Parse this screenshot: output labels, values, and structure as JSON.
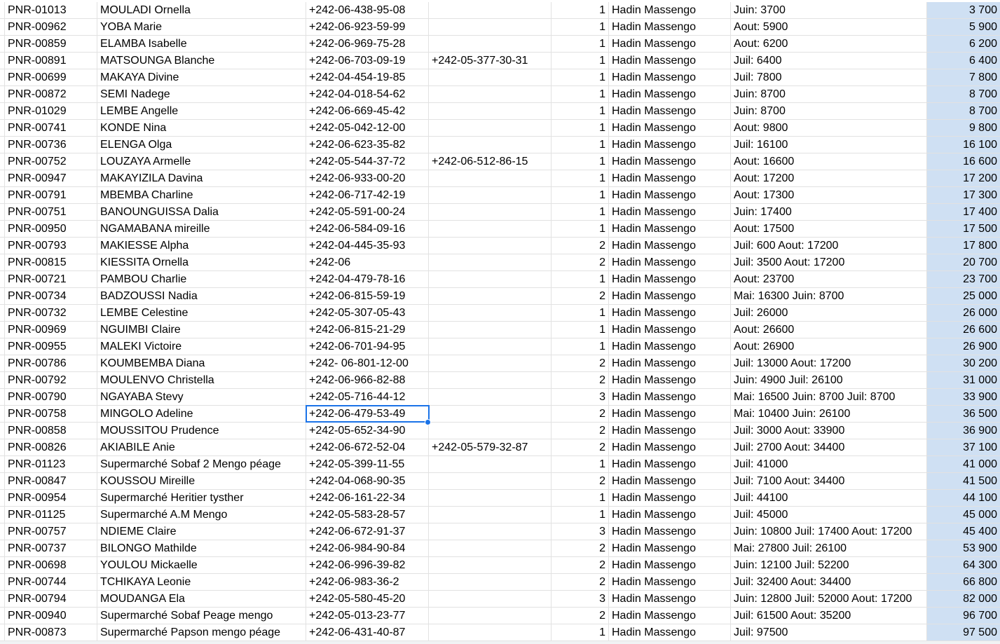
{
  "colors": {
    "grid": "#e2e2e2",
    "selection": "#1a73e8",
    "highlight_column": "#cfe0f3"
  },
  "selected_row_index": 24,
  "rows": [
    [
      "PNR-01013",
      "MOULADI Ornella",
      "+242-06-438-95-08",
      "",
      "1",
      "Hadin Massengo",
      "Juin: 3700",
      "3 700"
    ],
    [
      "PNR-00962",
      "YOBA Marie",
      "+242-06-923-59-99",
      "",
      "1",
      "Hadin Massengo",
      "Aout: 5900",
      "5 900"
    ],
    [
      "PNR-00859",
      "ELAMBA Isabelle",
      "+242-06-969-75-28",
      "",
      "1",
      "Hadin Massengo",
      "Aout: 6200",
      "6 200"
    ],
    [
      "PNR-00891",
      "MATSOUNGA Blanche",
      "+242-06-703-09-19",
      "+242-05-377-30-31",
      "1",
      "Hadin Massengo",
      "Juil: 6400",
      "6 400"
    ],
    [
      "PNR-00699",
      "MAKAYA Divine",
      "+242-04-454-19-85",
      "",
      "1",
      "Hadin Massengo",
      "Juil: 7800",
      "7 800"
    ],
    [
      "PNR-00872",
      "SEMI Nadege",
      "+242-04-018-54-62",
      "",
      "1",
      "Hadin Massengo",
      "Juin: 8700",
      "8 700"
    ],
    [
      "PNR-01029",
      "LEMBE Angelle",
      "+242-06-669-45-42",
      "",
      "1",
      "Hadin Massengo",
      "Juin: 8700",
      "8 700"
    ],
    [
      "PNR-00741",
      "KONDE Nina",
      "+242-05-042-12-00",
      "",
      "1",
      "Hadin Massengo",
      "Aout: 9800",
      "9 800"
    ],
    [
      "PNR-00736",
      "ELENGA Olga",
      "+242-06-623-35-82",
      "",
      "1",
      "Hadin Massengo",
      "Juil: 16100",
      "16 100"
    ],
    [
      "PNR-00752",
      "LOUZAYA Armelle",
      "+242-05-544-37-72",
      "+242-06-512-86-15",
      "1",
      "Hadin Massengo",
      "Aout: 16600",
      "16 600"
    ],
    [
      "PNR-00947",
      "MAKAYIZILA Davina",
      "+242-06-933-00-20",
      "",
      "1",
      "Hadin Massengo",
      "Aout: 17200",
      "17 200"
    ],
    [
      "PNR-00791",
      "MBEMBA Charline",
      "+242-06-717-42-19",
      "",
      "1",
      "Hadin Massengo",
      "Aout: 17300",
      "17 300"
    ],
    [
      "PNR-00751",
      "BANOUNGUISSA Dalia",
      "+242-05-591-00-24",
      "",
      "1",
      "Hadin Massengo",
      "Juin: 17400",
      "17 400"
    ],
    [
      "PNR-00950",
      "NGAMABANA mireille",
      "+242-06-584-09-16",
      "",
      "1",
      "Hadin Massengo",
      "Aout: 17500",
      "17 500"
    ],
    [
      "PNR-00793",
      "MAKIESSE Alpha",
      "+242-04-445-35-93",
      "",
      "2",
      "Hadin Massengo",
      "Juil: 600 Aout: 17200",
      "17 800"
    ],
    [
      "PNR-00815",
      "KIESSITA Ornella",
      "+242-06",
      "",
      "2",
      "Hadin Massengo",
      "Juil: 3500 Aout: 17200",
      "20 700"
    ],
    [
      "PNR-00721",
      "PAMBOU Charlie",
      "+242-04-479-78-16",
      "",
      "1",
      "Hadin Massengo",
      "Aout: 23700",
      "23 700"
    ],
    [
      "PNR-00734",
      "BADZOUSSI Nadia",
      "+242-06-815-59-19",
      "",
      "2",
      "Hadin Massengo",
      "Mai: 16300 Juin: 8700",
      "25 000"
    ],
    [
      "PNR-00732",
      "LEMBE Celestine",
      "+242-05-307-05-43",
      "",
      "1",
      "Hadin Massengo",
      "Juil: 26000",
      "26 000"
    ],
    [
      "PNR-00969",
      "NGUIMBI Claire",
      "+242-06-815-21-29",
      "",
      "1",
      "Hadin Massengo",
      "Aout: 26600",
      "26 600"
    ],
    [
      "PNR-00955",
      "MALEKI Victoire",
      "+242-06-701-94-95",
      "",
      "1",
      "Hadin Massengo",
      "Aout: 26900",
      "26 900"
    ],
    [
      "PNR-00786",
      "KOUMBEMBA Diana",
      "+242- 06-801-12-00",
      "",
      "2",
      "Hadin Massengo",
      "Juil: 13000 Aout: 17200",
      "30 200"
    ],
    [
      "PNR-00792",
      "MOULENVO Christella",
      "+242-06-966-82-88",
      "",
      "2",
      "Hadin Massengo",
      "Juin: 4900 Juil: 26100",
      "31 000"
    ],
    [
      "PNR-00790",
      "NGAYABA Stevy",
      "+242-05-716-44-12",
      "",
      "3",
      "Hadin Massengo",
      "Mai: 16500 Juin: 8700 Juil: 8700",
      "33 900"
    ],
    [
      "PNR-00758",
      "MINGOLO Adeline",
      "+242-06-479-53-49",
      "",
      "2",
      "Hadin Massengo",
      "Mai: 10400 Juin: 26100",
      "36 500"
    ],
    [
      "PNR-00858",
      "MOUSSITOU Prudence",
      "+242-05-652-34-90",
      "",
      "2",
      "Hadin Massengo",
      "Juil: 3000 Aout: 33900",
      "36 900"
    ],
    [
      "PNR-00826",
      "AKIABILE Anie",
      "+242-06-672-52-04",
      "+242-05-579-32-87",
      "2",
      "Hadin Massengo",
      "Juil: 2700 Aout: 34400",
      "37 100"
    ],
    [
      "PNR-01123",
      "Supermarché Sobaf 2 Mengo péage",
      "+242-05-399-11-55",
      "",
      "1",
      "Hadin Massengo",
      "Juil: 41000",
      "41 000"
    ],
    [
      "PNR-00847",
      "KOUSSOU Mireille",
      "+242-04-068-90-35",
      "",
      "2",
      "Hadin Massengo",
      "Juil: 7100 Aout: 34400",
      "41 500"
    ],
    [
      "PNR-00954",
      "Supermarché Heritier tysther",
      "+242-06-161-22-34",
      "",
      "1",
      "Hadin Massengo",
      "Juil: 44100",
      "44 100"
    ],
    [
      "PNR-01125",
      "Supermarché A.M Mengo",
      "+242-05-583-28-57",
      "",
      "1",
      "Hadin Massengo",
      "Juil: 45000",
      "45 000"
    ],
    [
      "PNR-00757",
      "NDIEME Claire",
      "+242-06-672-91-37",
      "",
      "3",
      "Hadin Massengo",
      "Juin: 10800 Juil: 17400 Aout: 17200",
      "45 400"
    ],
    [
      "PNR-00737",
      "BILONGO Mathilde",
      "+242-06-984-90-84",
      "",
      "2",
      "Hadin Massengo",
      "Mai: 27800 Juil: 26100",
      "53 900"
    ],
    [
      "PNR-00698",
      "YOULOU Mickaelle",
      "+242-06-996-39-82",
      "",
      "2",
      "Hadin Massengo",
      "Juin: 12100 Juil: 52200",
      "64 300"
    ],
    [
      "PNR-00744",
      "TCHIKAYA Leonie",
      "+242-06-983-36-2",
      "",
      "2",
      "Hadin Massengo",
      "Juil: 32400 Aout: 34400",
      "66 800"
    ],
    [
      "PNR-00794",
      "MOUDANGA Ela",
      "+242-05-580-45-20",
      "",
      "3",
      "Hadin Massengo",
      "Juin: 12800 Juil: 52000 Aout: 17200",
      "82 000"
    ],
    [
      "PNR-00940",
      "Supermarché Sobaf Peage mengo",
      "+242-05-013-23-77",
      "",
      "2",
      "Hadin Massengo",
      "Juil: 61500 Aout: 35200",
      "96 700"
    ],
    [
      "PNR-00873",
      "Supermarché Papson mengo péage",
      "+242-06-431-40-87",
      "",
      "1",
      "Hadin Massengo",
      "Juil: 97500",
      "97 500"
    ]
  ]
}
